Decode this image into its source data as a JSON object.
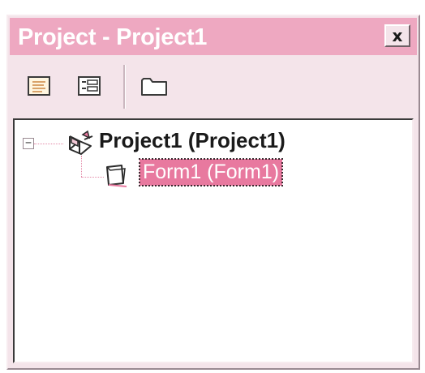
{
  "window": {
    "title": "Project - Project1",
    "close_glyph": "x"
  },
  "toolbar": {
    "buttons": [
      {
        "icon": "view-code-icon"
      },
      {
        "icon": "view-object-icon"
      },
      {
        "icon": "toggle-folders-icon"
      }
    ]
  },
  "tree": {
    "root": {
      "label": "Project1 (Project1)",
      "icon": "project-icon",
      "expander": "−",
      "expanded": true
    },
    "children": [
      {
        "label": "Form1 (Form1)",
        "icon": "form-icon",
        "selected": true
      }
    ]
  },
  "colors": {
    "titlebar": "#eea8c1",
    "selection": "#e8799f",
    "window_bg": "#f4e4ea"
  }
}
